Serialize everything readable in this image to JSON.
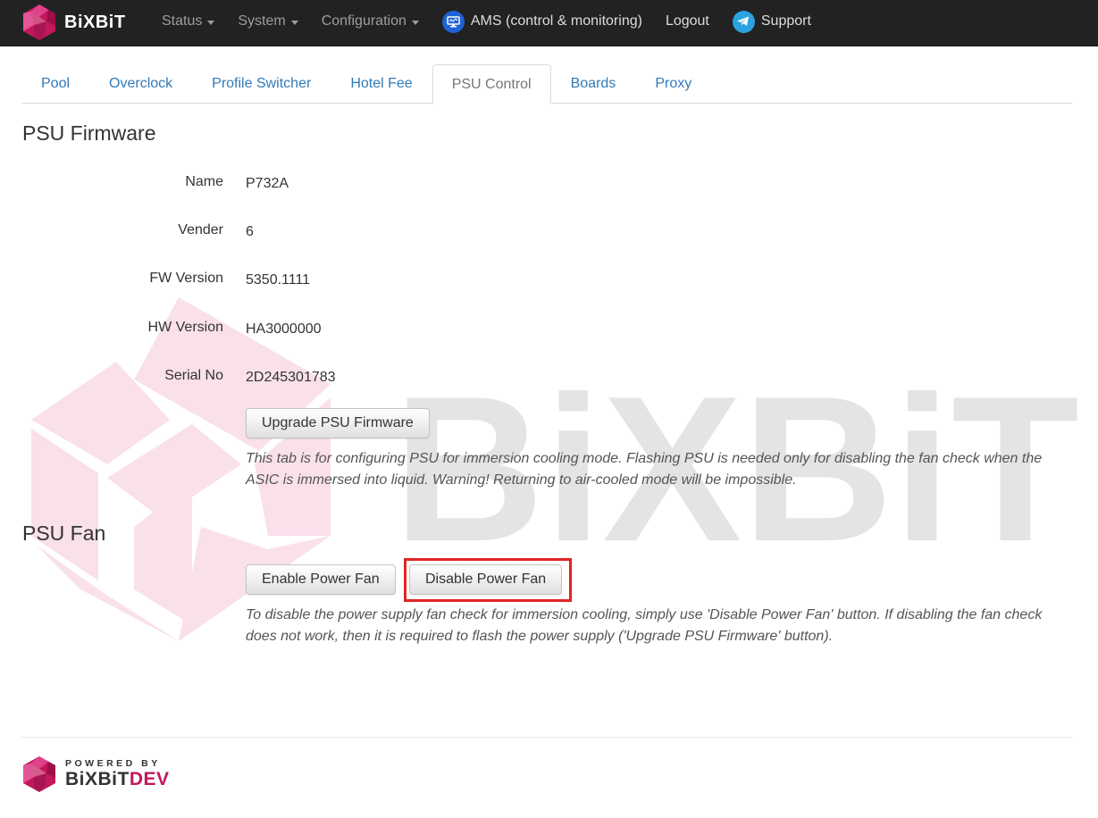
{
  "navbar": {
    "brand": "BiXBiT",
    "items": [
      {
        "label": "Status",
        "dropdown": true
      },
      {
        "label": "System",
        "dropdown": true
      },
      {
        "label": "Configuration",
        "dropdown": true
      },
      {
        "label": "AMS (control & monitoring)",
        "icon": "monitor-icon"
      },
      {
        "label": "Logout"
      },
      {
        "label": "Support",
        "icon": "telegram-icon"
      }
    ]
  },
  "tabs": [
    {
      "label": "Pool"
    },
    {
      "label": "Overclock"
    },
    {
      "label": "Profile Switcher"
    },
    {
      "label": "Hotel Fee"
    },
    {
      "label": "PSU Control",
      "active": true
    },
    {
      "label": "Boards"
    },
    {
      "label": "Proxy"
    }
  ],
  "firmware": {
    "title": "PSU Firmware",
    "rows": [
      {
        "label": "Name",
        "value": "P732A"
      },
      {
        "label": "Vender",
        "value": "6"
      },
      {
        "label": "FW Version",
        "value": "5350.1111"
      },
      {
        "label": "HW Version",
        "value": "HA3000000"
      },
      {
        "label": "Serial No",
        "value": "2D245301783"
      }
    ],
    "upgrade_button": "Upgrade PSU Firmware",
    "help": "This tab is for configuring PSU for immersion cooling mode. Flashing PSU is needed only for disabling the fan check when the ASIC is immersed into liquid. Warning! Returning to air-cooled mode will be impossible."
  },
  "fan": {
    "title": "PSU Fan",
    "enable_button": "Enable Power Fan",
    "disable_button": "Disable Power Fan",
    "help": "To disable the power supply fan check for immersion cooling, simply use 'Disable Power Fan' button. If disabling the fan check does not work, then it is required to flash the power supply ('Upgrade PSU Firmware' button)."
  },
  "watermark": {
    "text": "BiXBiT"
  },
  "footer": {
    "powered_by": "POWERED BY",
    "brand_part1": "BiXBiT",
    "brand_part2": "DEV"
  },
  "colors": {
    "navbar_bg": "#222222",
    "brand_magenta": "#c2185b",
    "link": "#337ab7",
    "highlight": "#e02424"
  }
}
